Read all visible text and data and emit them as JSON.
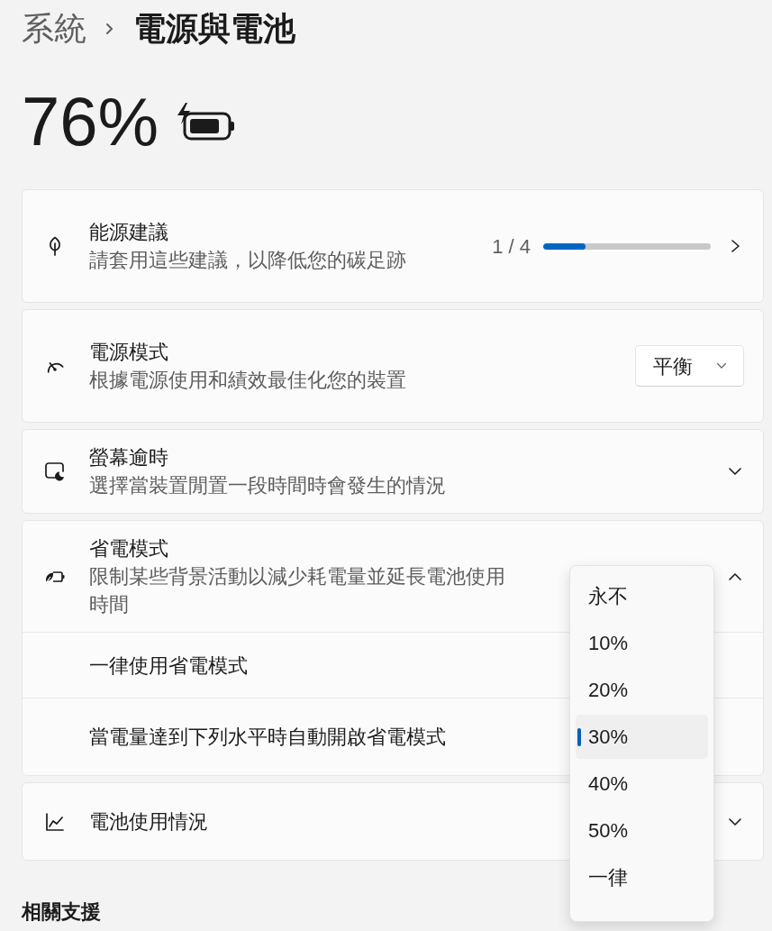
{
  "breadcrumb": {
    "parent": "系統",
    "current": "電源與電池"
  },
  "battery": {
    "percent": "76%",
    "charging": true
  },
  "cards": [
    {
      "kind": "progress",
      "title": "能源建議",
      "subtitle": "請套用這些建議，以降低您的碳足跡",
      "count": "1 / 4",
      "level": 0.25
    },
    {
      "kind": "select",
      "title": "電源模式",
      "subtitle": "根據電源使用和績效最佳化您的裝置",
      "value": "平衡"
    },
    {
      "kind": "expander",
      "title": "螢幕逾時",
      "subtitle": "選擇當裝置閒置一段時間時會發生的情況",
      "expanded": false
    },
    {
      "kind": "expander",
      "title": "省電模式",
      "subtitle": "限制某些背景活動以減少耗電量並延長電池使用時間",
      "expanded": true,
      "rows": [
        {
          "label": "一律使用省電模式"
        },
        {
          "label": "當電量達到下列水平時自動開啟省電模式"
        }
      ]
    },
    {
      "kind": "expander",
      "title": "電池使用情況",
      "expanded": false
    }
  ],
  "dropdown_menu": {
    "options": [
      {
        "label": "永不",
        "selected": false
      },
      {
        "label": "10%",
        "selected": false
      },
      {
        "label": "20%",
        "selected": false
      },
      {
        "label": "30%",
        "selected": true
      },
      {
        "label": "40%",
        "selected": false
      },
      {
        "label": "50%",
        "selected": false
      },
      {
        "label": "一律",
        "selected": false
      }
    ]
  },
  "section_heading": "相關支援"
}
